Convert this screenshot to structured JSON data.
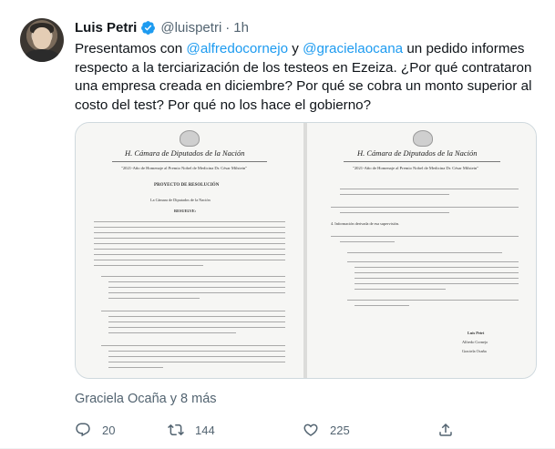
{
  "author": {
    "name": "Luis Petri",
    "handle": "@luispetri",
    "separator": "·",
    "time": "1h"
  },
  "tweet": {
    "text_a": "Presentamos con ",
    "mention_1": "@alfredocornejo",
    "text_b": " y ",
    "mention_2": "@gracielaocana",
    "text_c": " un pedido informes respecto a la terciarización de los testeos en Ezeiza. ¿Por qué contrataron una empresa creada en diciembre? Por qué se cobra un monto superior al costo del test? Por qué no los hace el gobierno?"
  },
  "media": {
    "left_page": {
      "title": "H. Cámara de Diputados de la Nación",
      "year_note": "\"2021-Año de Homenaje al Premio Nobel de Medicina Dr. César Milstein\"",
      "heading": "PROYECTO DE RESOLUCIÓN",
      "intro": "La Cámara de Diputados de la Nación",
      "resuelve": "RESUELVE:"
    },
    "right_page": {
      "title": "H. Cámara de Diputados de la Nación",
      "year_note": "\"2021-Año de Homenaje al Premio Nobel de Medicina Dr. César Milstein\"",
      "item_4": "4.   Información derivada de esa supervisión.",
      "signer_1": "Luis Petri",
      "signer_2": "Alfredo Cornejo",
      "signer_3": "Graciela Ocaña"
    }
  },
  "reactions_line": "Graciela Ocaña y 8 más",
  "actions": {
    "reply_count": "20",
    "retweet_count": "144",
    "like_count": "225"
  },
  "colors": {
    "accent": "#1d9bf0",
    "secondary_text": "#536471",
    "border": "#cfd9de"
  },
  "icons": {
    "verified": "verified-badge-icon",
    "reply": "reply-icon",
    "retweet": "retweet-icon",
    "like": "heart-icon",
    "share": "share-icon"
  }
}
